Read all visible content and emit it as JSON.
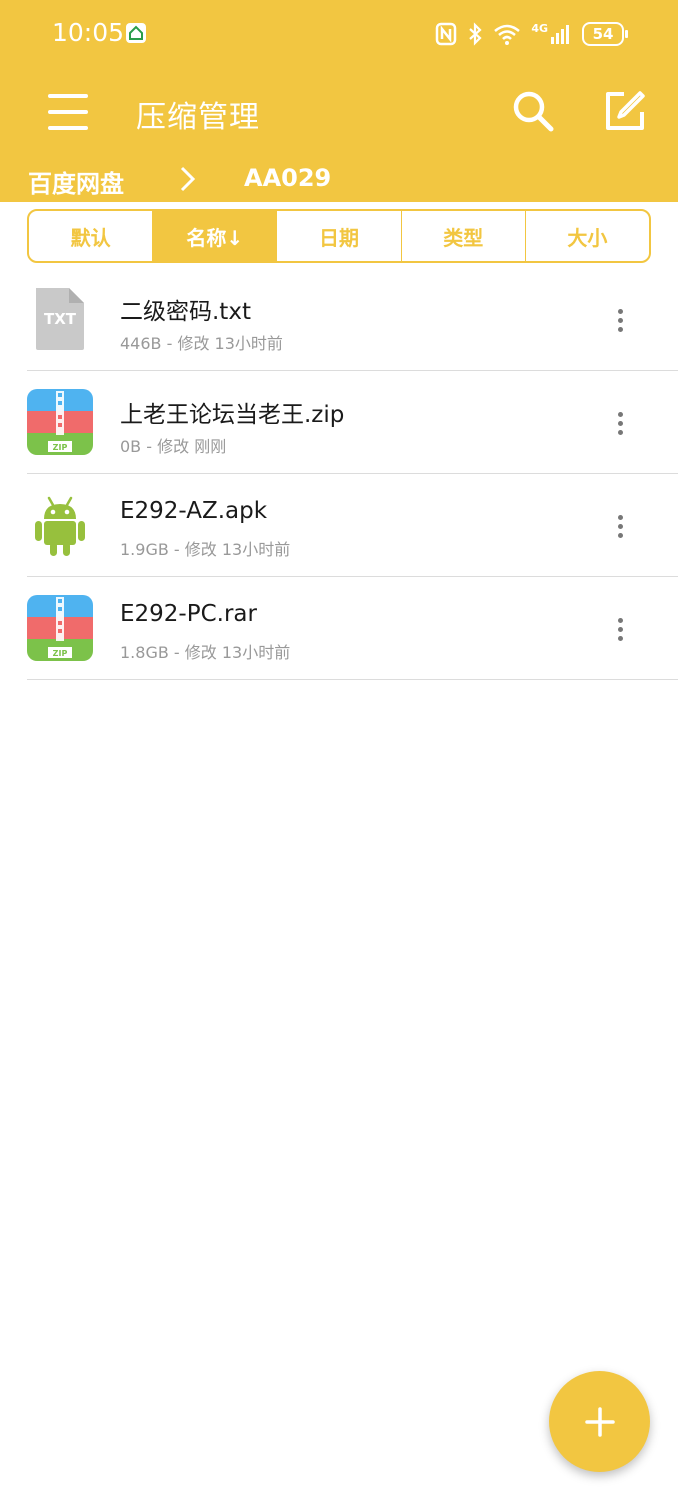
{
  "status_bar": {
    "time": "10:05",
    "battery": "54",
    "network": "4G"
  },
  "app_bar": {
    "title": "压缩管理"
  },
  "breadcrumb": {
    "root": "百度网盘",
    "current": "AA029"
  },
  "sort_tabs": [
    {
      "label": "默认",
      "active": false
    },
    {
      "label": "名称↓",
      "active": true
    },
    {
      "label": "日期",
      "active": false
    },
    {
      "label": "类型",
      "active": false
    },
    {
      "label": "大小",
      "active": false
    }
  ],
  "files": [
    {
      "name": "二级密码.txt",
      "meta": "446B - 修改 13小时前",
      "icon": "txt-file-icon",
      "icon_text": "TXT"
    },
    {
      "name": "上老王论坛当老王.zip",
      "meta": "0B - 修改 刚刚",
      "icon": "zip-archive-icon",
      "icon_text": "ZIP"
    },
    {
      "name": "E292-AZ.apk",
      "meta": "1.9GB - 修改 13小时前",
      "icon": "android-apk-icon"
    },
    {
      "name": "E292-PC.rar",
      "meta": "1.8GB - 修改 13小时前",
      "icon": "zip-archive-icon",
      "icon_text": "ZIP"
    }
  ],
  "colors": {
    "accent": "#F2C641",
    "zip_blue": "#4FB3F0",
    "zip_red": "#F06B6B",
    "zip_green": "#7CC24A",
    "android_green": "#97C03D",
    "txt_gray": "#C9C9C9"
  }
}
